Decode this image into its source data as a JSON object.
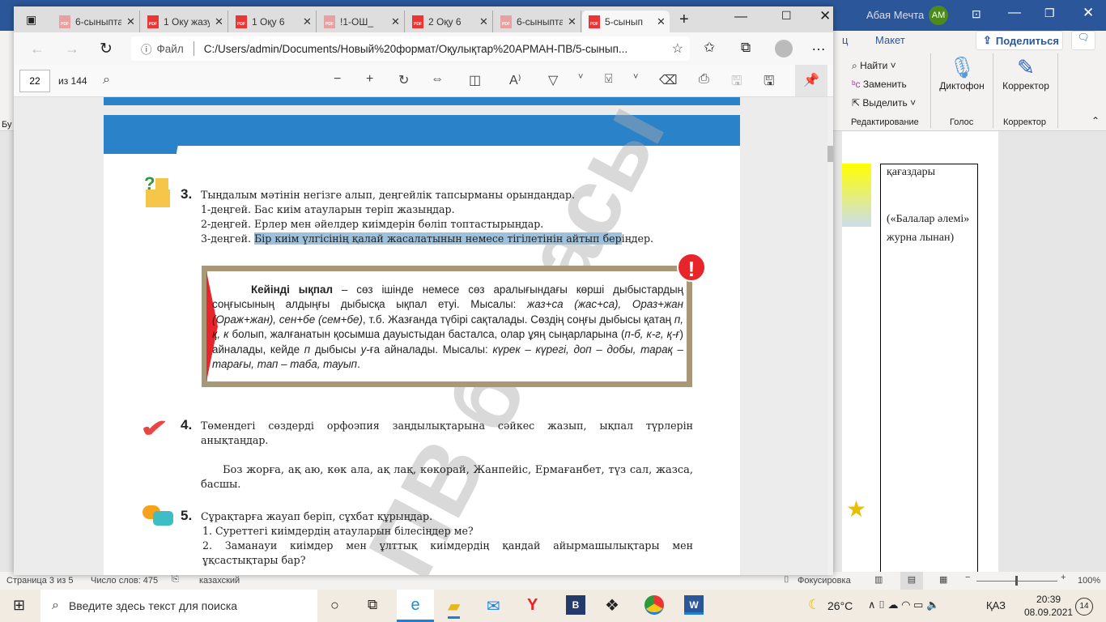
{
  "word": {
    "user": "Абая Мечта",
    "avatar": "АМ",
    "ribbon_tab_partial": "ц",
    "ribbon_tab_layout": "Макет",
    "share": "Поделиться",
    "find": "Найти",
    "replace": "Заменить",
    "select": "Выделить",
    "group_editing": "Редактирование",
    "dictate": "Диктофон",
    "group_voice": "Голос",
    "editor": "Корректор",
    "group_editor": "Корректор",
    "left_partial": "Бу",
    "doc_cell_1": "қағаздары",
    "doc_cell_2": "(«Балалар әлемі» журна лынан)",
    "status": {
      "page": "Страница 3 из 5",
      "words": "Число слов: 475",
      "lang": "казахский",
      "focus": "Фокусировка",
      "zoom": "100%"
    }
  },
  "browser": {
    "tabs": [
      {
        "label": "6-сыныптар",
        "active": false
      },
      {
        "label": "1 Оку жазу",
        "active": false
      },
      {
        "label": "1 Оқу 6",
        "active": false
      },
      {
        "label": "!1-ОШ_",
        "active": false
      },
      {
        "label": "2 Оқу 6",
        "active": false
      },
      {
        "label": "6-сыныптар",
        "active": false
      },
      {
        "label": "5-сынып",
        "active": true
      }
    ],
    "file_label": "Файл",
    "url": "C:/Users/admin/Documents/Новый%20формат/Оқулықтар%20АРМАН-ПВ/5-сынып...",
    "page_num": "22",
    "page_total": "из 144"
  },
  "pdf": {
    "watermark": "ПВ басасы",
    "t3": {
      "num": "3.",
      "lines": [
        "Тыңдалым мәтінін негізге алып, деңгейлік тапсырманы орындаңдар.",
        "1-деңгей. Бас киім атауларын теріп жазыңдар.",
        "2-деңгей. Ерлер мен әйелдер киімдерін бөліп топтастырыңдар."
      ],
      "l4_pre": "3-деңгей. ",
      "l4_sel": "Бір киім үлгісінің қалай жасалатынын немесе тігілетінін айтып бер",
      "l4_post": "іңдер."
    },
    "rule": {
      "term": "Кейінді ықпал",
      "p1": " – сөз ішінде немесе сөз аралығындағы көрші дыбыстардың соңғысының алдыңғы дыбысқа ықпал етуі. Мысалы: ",
      "e1": "жаз+са (жас+са), Ораз+жан (Ораж+жан), сен+бе (сем+бе)",
      "p2": ", т.б. Жазғанда түбірі сақталады. Сөздің соңғы дыбысы қатаң ",
      "e2": "п, қ, к",
      "p3": " болып, жалғанатын қосымша дауыстыдан басталса, олар ұяң сыңарларына (",
      "e3": "п-б, к-г, қ-ғ",
      "p4": ") айналады, кейде ",
      "e4": "п",
      "p5": " дыбысы ",
      "e5": "у",
      "p6": "-ға айналады. Мысалы: ",
      "e6": "күрек – күрегі, доп – добы, тарақ – тарағы, тап – таба, тауып",
      "p7": "."
    },
    "t4": {
      "num": "4.",
      "text": "Төмендегі сөздерді орфоэпия заңдылықтарына сәйкес жазып, ықпал түрлерін анықтаңдар.",
      "words": "Боз жорға, ақ аю, көк ала, ақ лақ, көкорай, Жанпейіс, Ермағанбет, түз сал, жазса, басшы."
    },
    "t5": {
      "num": "5.",
      "text": "Сұрақтарға жауап беріп, сұхбат құрыңдар.",
      "q1": "1.  Суреттегі киімдердің атауларын білесіңдер ме?",
      "q2": "2.  Заманауи киімдер мен ұлттық киімдердің қандай айырмашылықтары мен ұқсастықтары бар?"
    }
  },
  "taskbar": {
    "search_placeholder": "Введите здесь текст для поиска",
    "temp": "26°C",
    "lang": "ҚАЗ",
    "time": "20:39",
    "date": "08.09.2021",
    "notif": "14"
  }
}
